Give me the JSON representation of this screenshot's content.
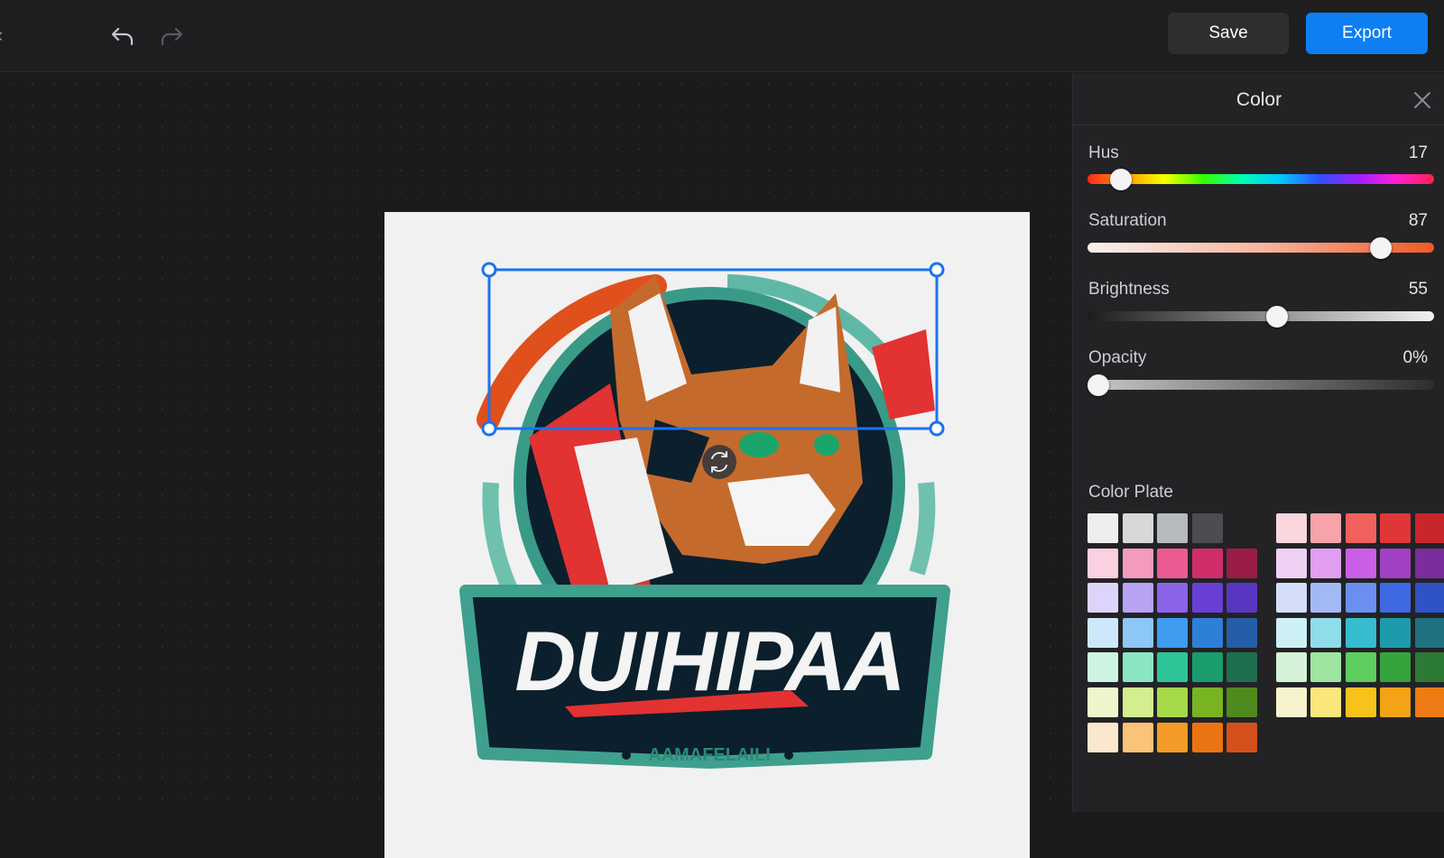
{
  "toolbar": {
    "back_icon": "chevron-left-icon",
    "undo_icon": "undo-icon",
    "redo_icon": "redo-icon",
    "save_label": "Save",
    "export_label": "Export",
    "accent": "#0d7ff2"
  },
  "canvas": {
    "logo_text": "DUIHIPAA",
    "logo_subtext": "AAMAFELAILI",
    "rotate_icon": "rotate-icon",
    "selection_color": "#1a73f0"
  },
  "panel": {
    "title": "Color",
    "close_icon": "close-icon",
    "sliders": [
      {
        "id": "hue",
        "label": "Hus",
        "value": "17",
        "level": 0.07
      },
      {
        "id": "saturation",
        "label": "Saturation",
        "value": "87",
        "level": 0.87
      },
      {
        "id": "brightness",
        "label": "Brightness",
        "value": "55",
        "level": 0.55
      },
      {
        "id": "opacity",
        "label": "Opacity",
        "value": "0%",
        "level": 0.0
      }
    ],
    "plate_label": "Color Plate",
    "plate_rows": [
      [
        "#eeeeee",
        "#d8d8da",
        "#b6babe",
        "#4c4d52",
        null,
        "#fbd6dd",
        "#f6a3a9",
        "#f0615d",
        "#e13638",
        "#c9262c"
      ],
      [
        "#fbd0e0",
        "#f49bbd",
        "#eb5a93",
        "#cf2e6a",
        "#9a1d47",
        "#efd1f4",
        "#e29ef0",
        "#cb5ee6",
        "#a240c4",
        "#7c2d9c"
      ],
      [
        "#ddd4fb",
        "#b7a2f4",
        "#8c64ea",
        "#6a3fd6",
        "#5836c2",
        "#d4def9",
        "#a3b9f6",
        "#6b8ff0",
        "#3f69e2",
        "#2f52c4"
      ],
      [
        "#cde7fb",
        "#8cc7f6",
        "#3d9cef",
        "#2d7fd8",
        "#255ea8",
        "#cdeff6",
        "#8fdcea",
        "#35bccf",
        "#1e9aad",
        "#1e727f"
      ],
      [
        "#cdf3e2",
        "#8ae5c3",
        "#2dc597",
        "#1a9c6d",
        "#1e6f4f",
        "#d5f2d8",
        "#9fe49f",
        "#5ccd5e",
        "#35a43c",
        "#2d7a36"
      ],
      [
        "#eef5cd",
        "#d3ee8f",
        "#a6d94a",
        "#78b324",
        "#4f8a1f",
        "#f7f3cc",
        "#fbe67b",
        "#f8c21d",
        "#f4a216",
        "#ee7b13"
      ],
      [
        "#fbe7cd",
        "#fbc27a",
        "#f49b27",
        "#ea7412",
        "#d4501c"
      ]
    ]
  }
}
